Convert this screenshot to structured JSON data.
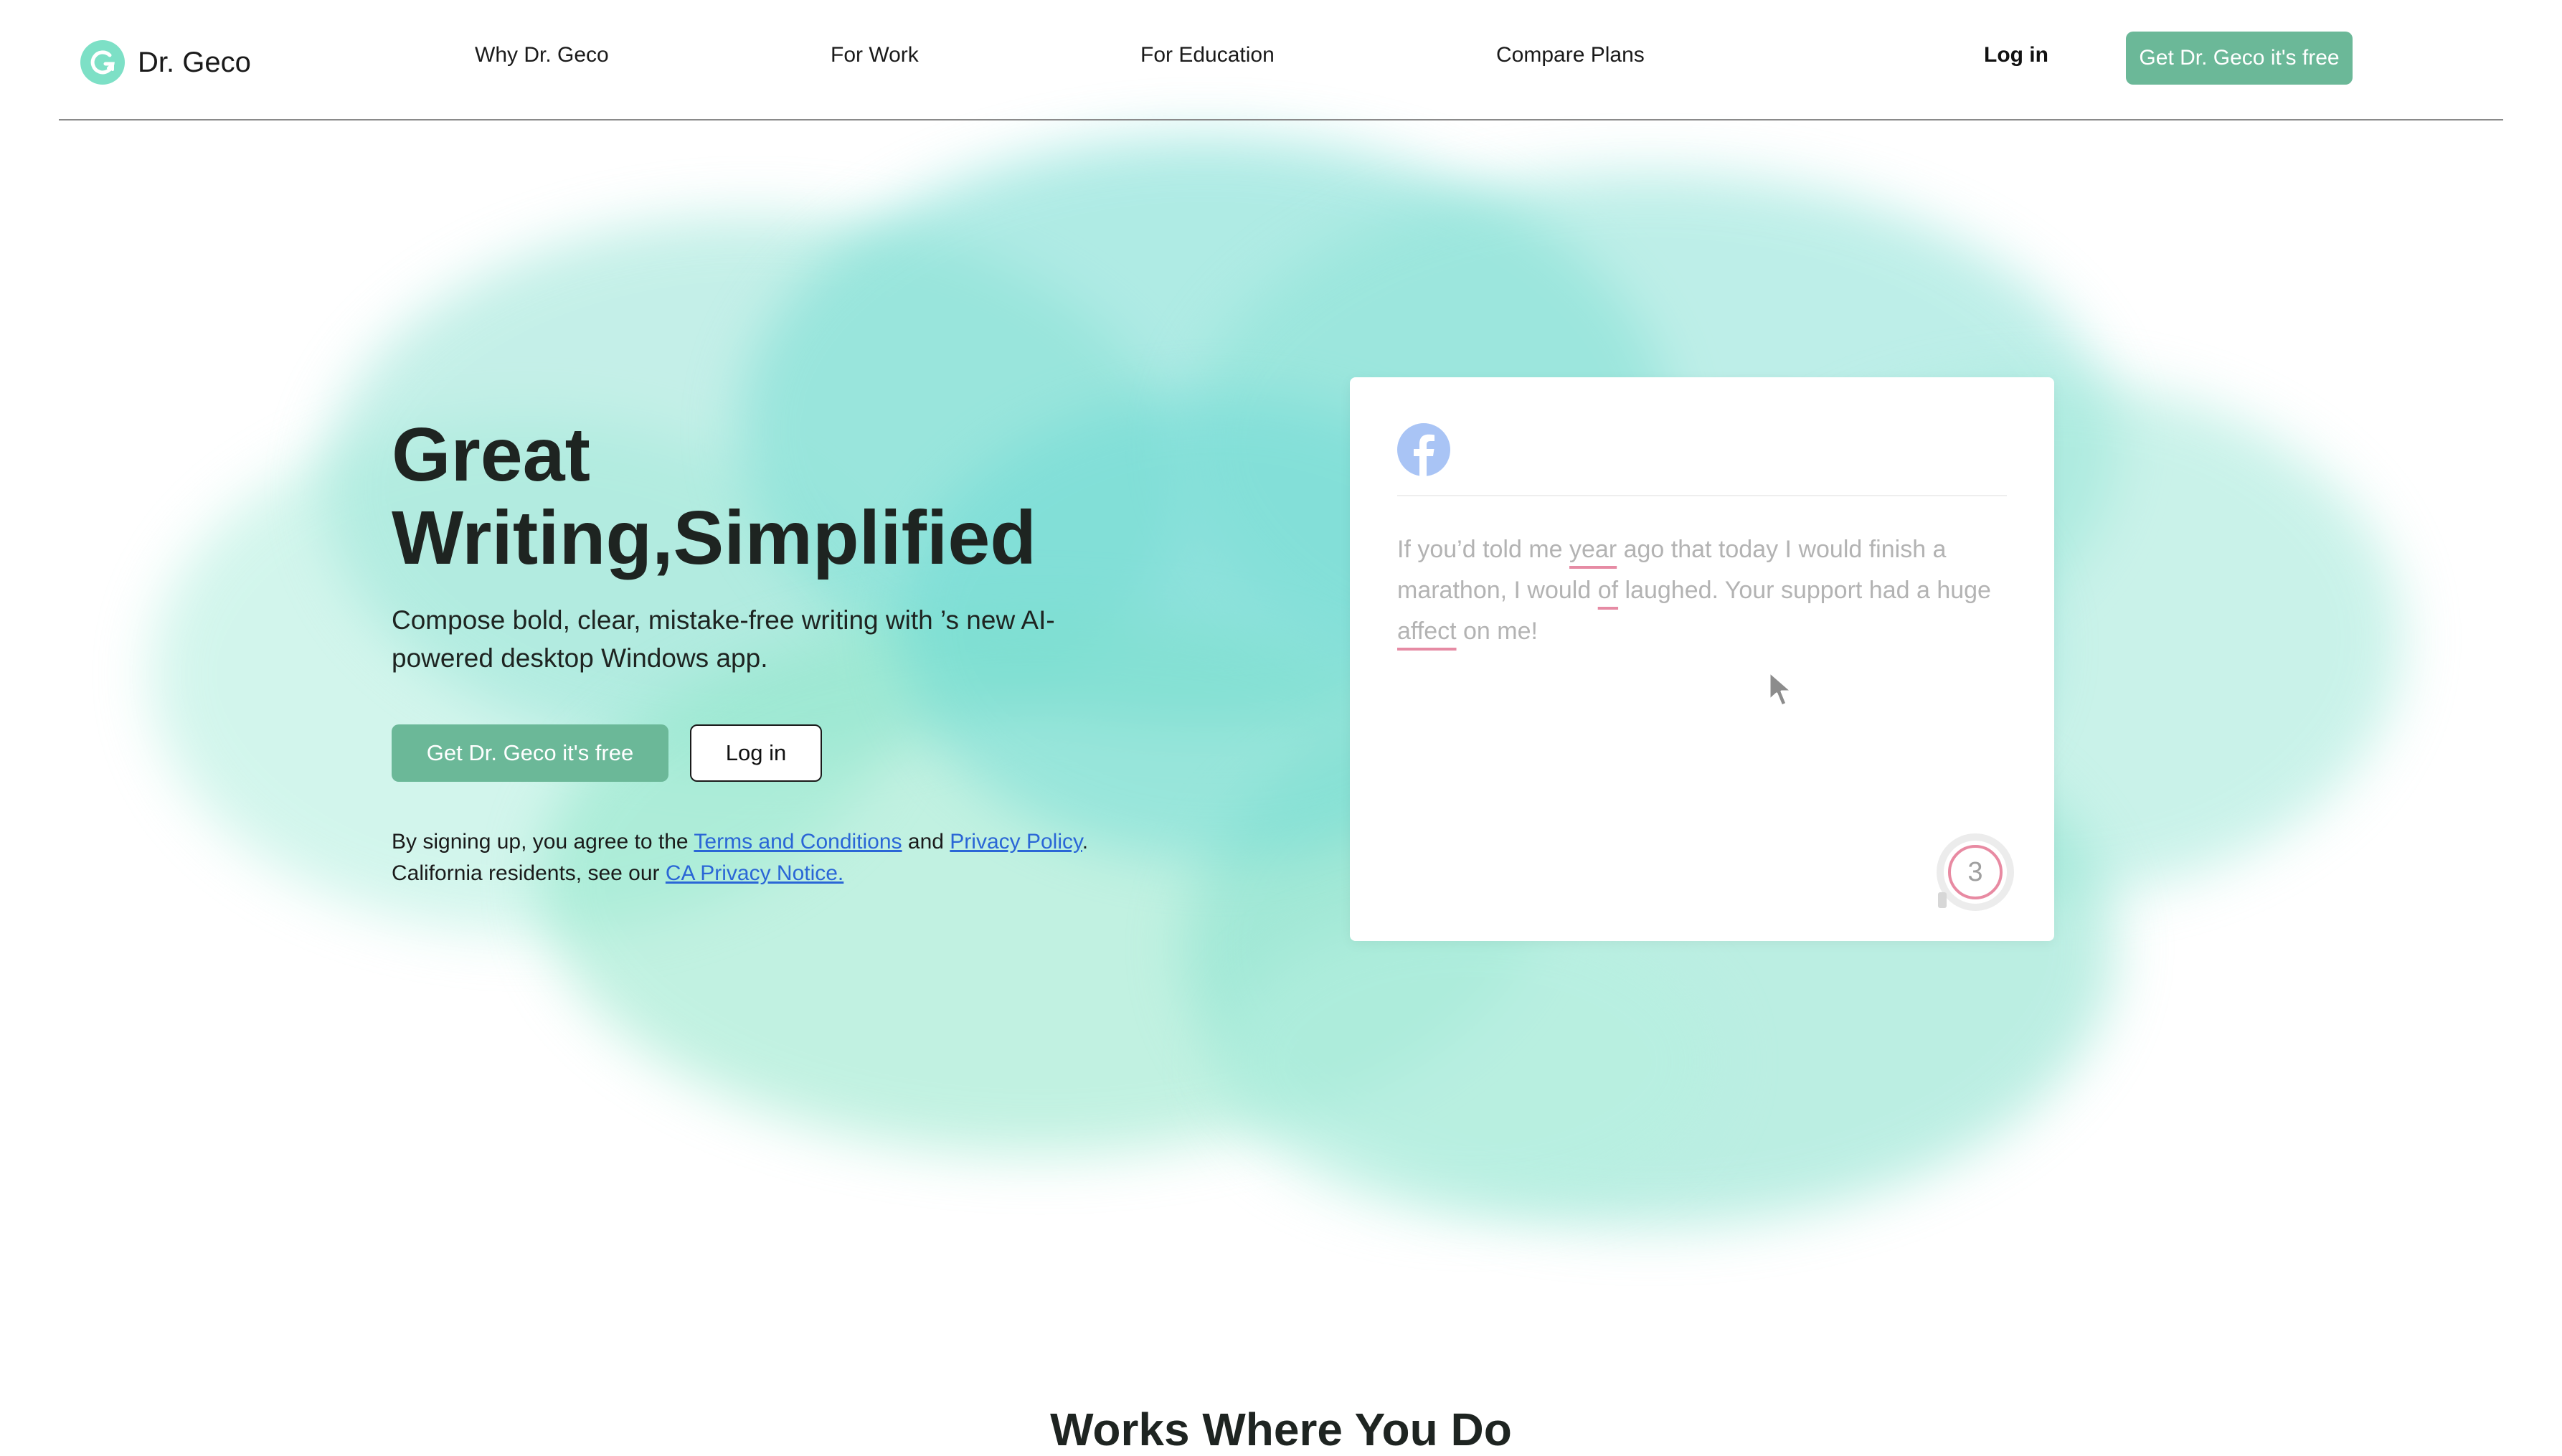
{
  "brand": {
    "name": "Dr. Geco"
  },
  "nav": {
    "items": [
      {
        "label": "Why Dr. Geco"
      },
      {
        "label": "For Work"
      },
      {
        "label": "For Education"
      },
      {
        "label": "Compare Plans"
      }
    ],
    "login_label": "Log in",
    "cta_label": "Get Dr. Geco it's free"
  },
  "hero": {
    "title_line1": "Great",
    "title_line2": "Writing,Simplified",
    "subtitle": "Compose bold, clear, mistake-free writing with ’s new AI-powered desktop Windows app.",
    "primary_button": "Get Dr. Geco it's free",
    "secondary_button": "Log in",
    "legal": {
      "prefix": "By signing up, you agree to the ",
      "terms_link": "Terms and Conditions",
      "and_text": " and ",
      "privacy_link": "Privacy Policy",
      "mid_text": ". California residents, see our ",
      "ca_link": "CA Privacy Notice."
    }
  },
  "demo_card": {
    "icon": "facebook-icon",
    "text_parts": [
      {
        "text": "If you’d told me ",
        "error": false
      },
      {
        "text": "year",
        "error": true
      },
      {
        "text": " ago that today I would finish a marathon, I would ",
        "error": false
      },
      {
        "text": "of",
        "error": true
      },
      {
        "text": " laughed. Your support had a huge ",
        "error": false
      },
      {
        "text": "affect",
        "error": true
      },
      {
        "text": " on me!",
        "error": false
      }
    ],
    "suggestion_count": "3"
  },
  "section": {
    "title": "Works Where You Do"
  },
  "colors": {
    "accent": "#6bb898",
    "logo": "#7de0c6",
    "link": "#2a66d6",
    "error_underline": "#e68ba4",
    "facebook": "#a9c4f5"
  }
}
